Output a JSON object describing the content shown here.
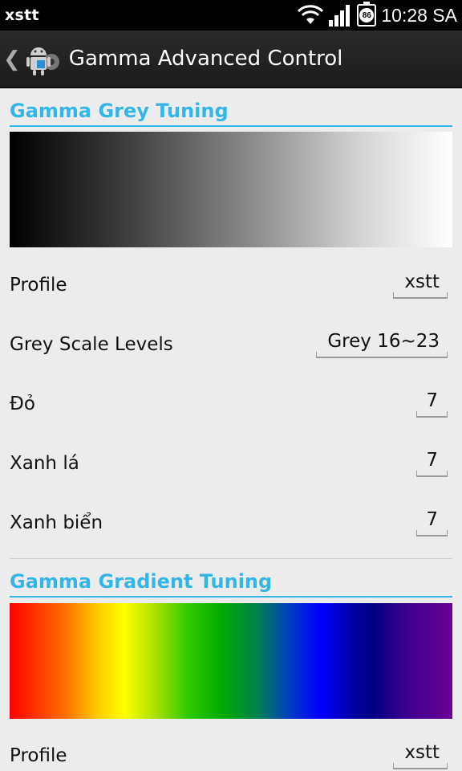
{
  "status_bar": {
    "carrier": "xstt",
    "battery_level": "86",
    "time": "10:28 SA"
  },
  "action_bar": {
    "title": "Gamma Advanced Control",
    "back_icon": "chevron-left-icon",
    "app_icon": "android-settings-icon"
  },
  "grey_section": {
    "header": "Gamma Grey Tuning",
    "rows": [
      {
        "label": "Profile",
        "value": "xstt"
      },
      {
        "label": "Grey Scale Levels",
        "value": "Grey 16~23"
      },
      {
        "label": "Đỏ",
        "value": "7"
      },
      {
        "label": "Xanh lá",
        "value": "7"
      },
      {
        "label": "Xanh biển",
        "value": "7"
      }
    ]
  },
  "gradient_section": {
    "header": "Gamma Gradient Tuning",
    "rows": [
      {
        "label": "Profile",
        "value": "xstt"
      }
    ]
  },
  "colors": {
    "accent": "#33b5e5",
    "status_bar_bg": "#000000",
    "action_bar_bg": "#222222",
    "content_bg": "#ececec"
  }
}
